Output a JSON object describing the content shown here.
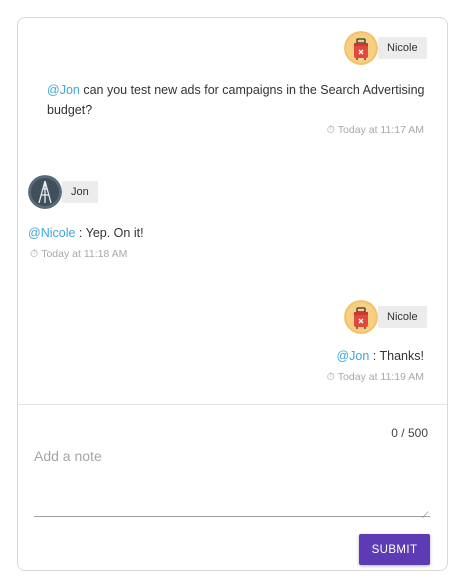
{
  "colors": {
    "accent": "#5c3bb5",
    "mention": "#3fa7d6",
    "timestamp": "#a8a8a8",
    "chip_bg": "#ececec"
  },
  "messages": [
    {
      "author": "Nicole",
      "avatar_icon": "suitcase-icon",
      "mention": "@Jon",
      "text": " can you test new ads for campaigns in the Search Advertising budget?",
      "time": "Today at 11:17 AM",
      "align": "right"
    },
    {
      "author": "Jon",
      "avatar_icon": "tower-icon",
      "mention": "@Nicole",
      "text": " : Yep. On it!",
      "time": "Today at 11:18 AM",
      "align": "left"
    },
    {
      "author": "Nicole",
      "avatar_icon": "suitcase-icon",
      "mention": "@Jon",
      "text": " : Thanks!",
      "time": "Today at 11:19 AM",
      "align": "right"
    }
  ],
  "composer": {
    "counter": "0 / 500",
    "placeholder": "Add a note",
    "value": "",
    "submit_label": "SUBMIT"
  }
}
